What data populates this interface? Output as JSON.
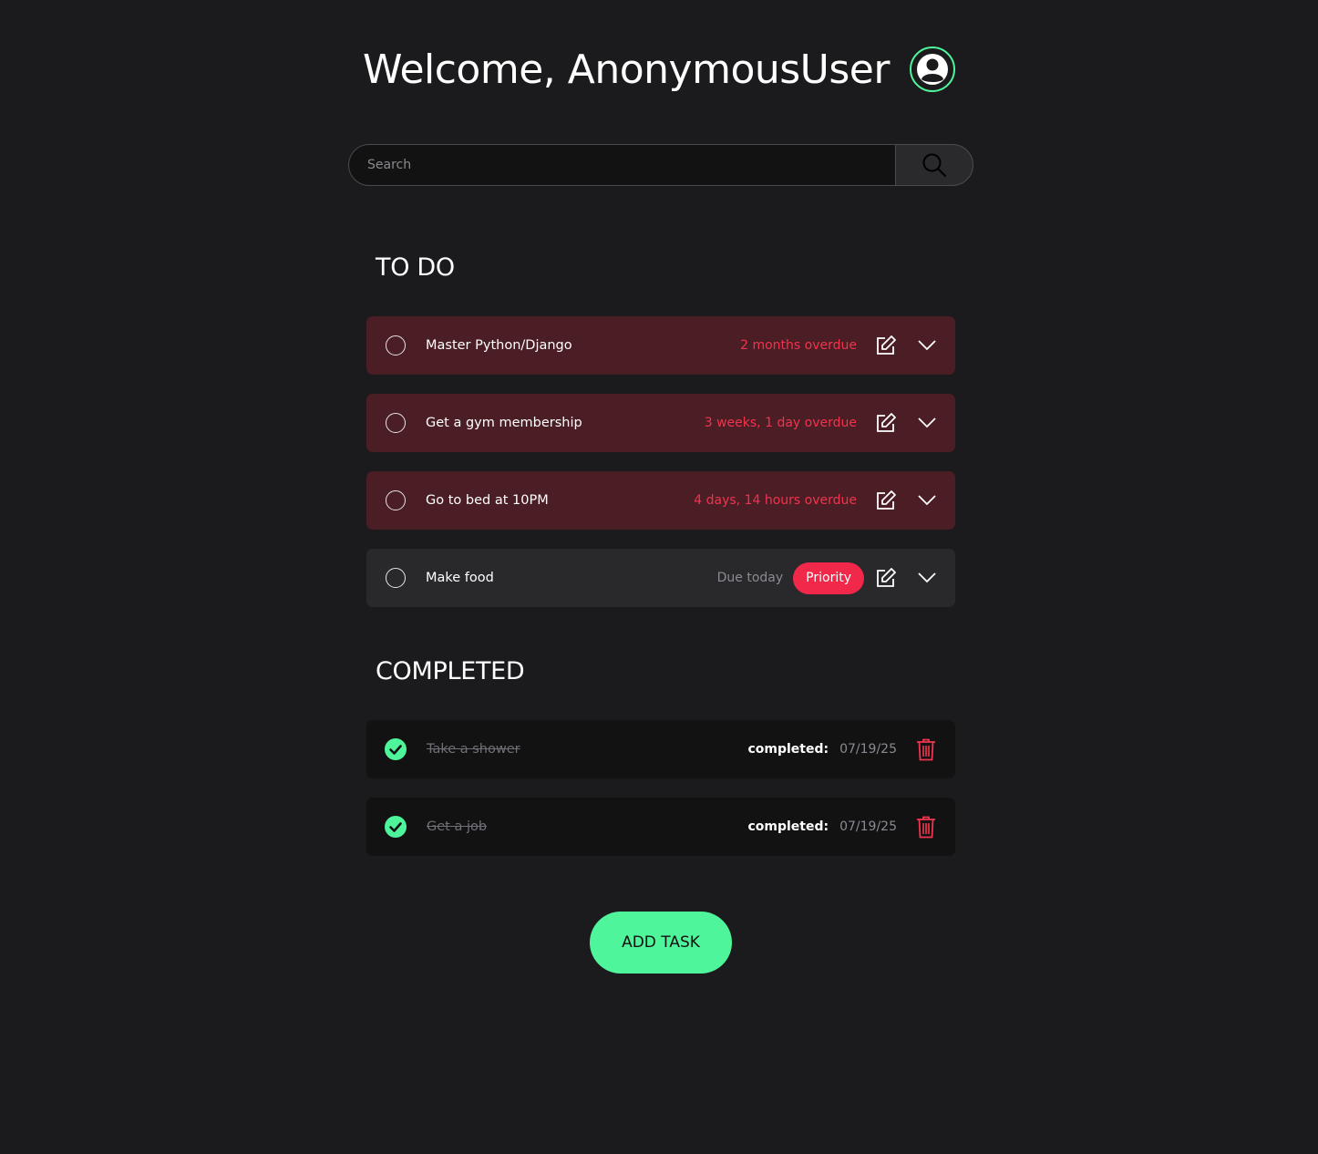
{
  "header": {
    "welcome": "Welcome, AnonymousUser",
    "avatar_icon": "user-circle-icon"
  },
  "search": {
    "placeholder": "Search",
    "button_icon": "search-icon"
  },
  "todo": {
    "title": "TO DO",
    "tasks": [
      {
        "name": "Master Python/Django",
        "due": "2 months overdue",
        "status": "overdue",
        "priority": null
      },
      {
        "name": "Get a gym membership",
        "due": "3 weeks, 1 day overdue",
        "status": "overdue",
        "priority": null
      },
      {
        "name": "Go to bed at 10PM",
        "due": "4 days, 14 hours overdue",
        "status": "overdue",
        "priority": null
      },
      {
        "name": "Make food",
        "due": "Due today",
        "status": "normal",
        "priority": "Priority"
      }
    ]
  },
  "completed": {
    "title": "COMPLETED",
    "tasks": [
      {
        "name": "Take a shower",
        "label": "completed:",
        "date": "07/19/25"
      },
      {
        "name": "Get a job",
        "label": "completed:",
        "date": "07/19/25"
      }
    ]
  },
  "actions": {
    "add_task": "ADD TASK"
  },
  "colors": {
    "accent": "#4ff59b",
    "overdue_bg": "#4b1d24",
    "overdue_text": "#f0344f",
    "priority_bg": "#f1284a",
    "background": "#1b1b1d"
  }
}
